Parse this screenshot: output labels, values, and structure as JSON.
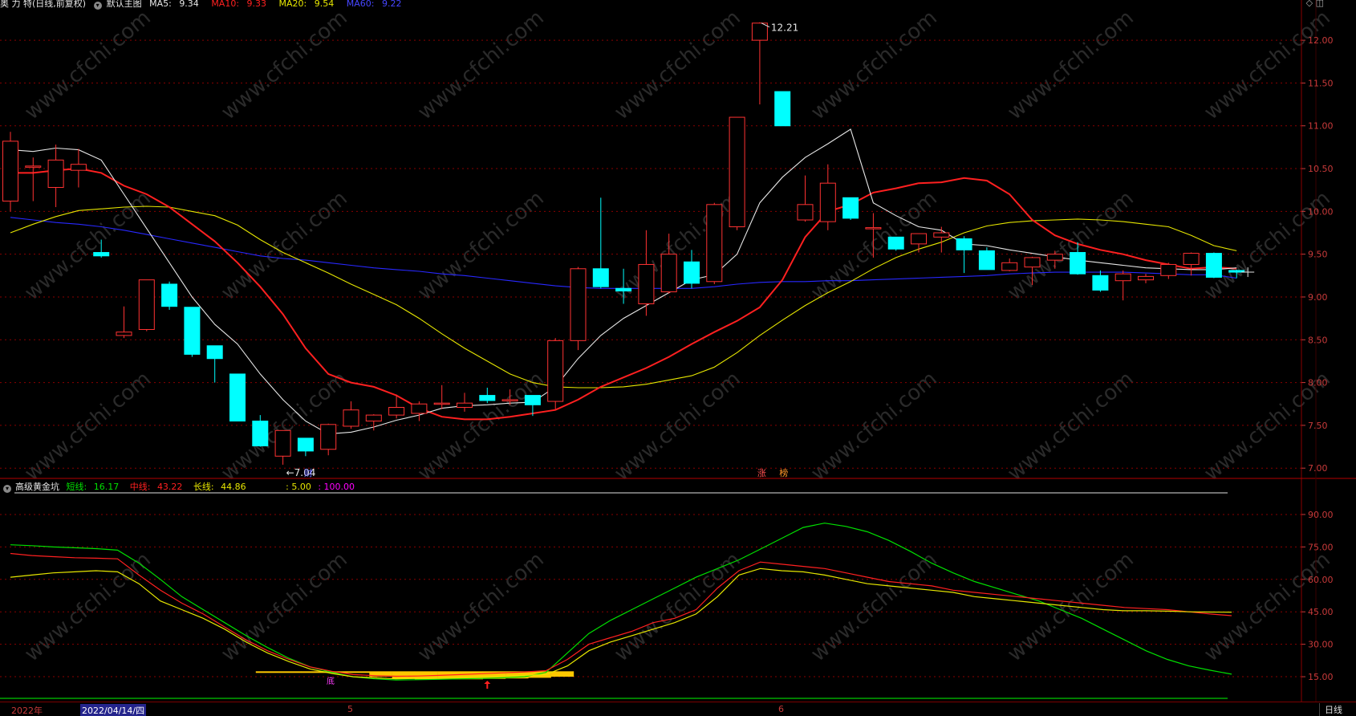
{
  "main_header": {
    "name": "奥 力 特(日线,前复权)",
    "template": "默认主图",
    "ma5_label": "MA5:",
    "ma5_value": "9.34",
    "ma10_label": "MA10:",
    "ma10_value": "9.33",
    "ma20_label": "MA20:",
    "ma20_value": "9.54",
    "ma60_label": "MA60:",
    "ma60_value": "9.22"
  },
  "indicator_header": {
    "name": "高级黄金坑",
    "short_label": "短线:",
    "short_value": "16.17",
    "mid_label": "中线:",
    "mid_value": "43.22",
    "long_label": "长线:",
    "long_value": "44.86",
    "extra1": ": 5.00",
    "extra2": ": 100.00"
  },
  "annotations": {
    "high_label": "12.21",
    "low_label": "7.04",
    "cai_mark": "财",
    "zhang_mark": "涨",
    "bang_mark": "榜",
    "low_zone_mark": "底"
  },
  "bottom_bar": {
    "year": "2022年",
    "cursor_date": "2022/04/14/四",
    "month5": "5",
    "month6": "6",
    "period": "日线"
  },
  "watermark": "www.cfchi.com",
  "colors": {
    "up": "#ff3232",
    "down": "#00ffff",
    "ma5": "#e6e6e6",
    "ma10": "#ff2020",
    "ma20": "#e6e600",
    "ma60": "#2828ff",
    "short": "#00e000",
    "mid": "#ff2020",
    "long": "#e6e600",
    "fill": "#ffc800",
    "grid": "#8a0000"
  },
  "chart_data": [
    {
      "type": "candlestick",
      "title": "奥 力 特(日线,前复权)",
      "y_ticks": [
        7.0,
        7.5,
        8.0,
        8.5,
        9.0,
        9.5,
        10.0,
        10.5,
        11.0,
        11.5,
        12.0
      ],
      "ylim": [
        6.88,
        12.32
      ],
      "candles": [
        {
          "o": 10.12,
          "h": 10.93,
          "l": 10.0,
          "c": 10.82
        },
        {
          "o": 10.53,
          "h": 10.63,
          "l": 10.12,
          "c": 10.53
        },
        {
          "o": 10.28,
          "h": 10.78,
          "l": 10.05,
          "c": 10.6
        },
        {
          "o": 10.48,
          "h": 10.73,
          "l": 10.28,
          "c": 10.55
        },
        {
          "o": 9.52,
          "h": 9.67,
          "l": 9.46,
          "c": 9.48
        },
        {
          "o": 8.55,
          "h": 8.89,
          "l": 8.52,
          "c": 8.59
        },
        {
          "o": 8.62,
          "h": 9.2,
          "l": 8.6,
          "c": 9.2
        },
        {
          "o": 9.15,
          "h": 9.18,
          "l": 8.85,
          "c": 8.89
        },
        {
          "o": 8.88,
          "h": 8.88,
          "l": 8.3,
          "c": 8.33
        },
        {
          "o": 8.43,
          "h": 8.43,
          "l": 8.0,
          "c": 8.28
        },
        {
          "o": 8.1,
          "h": 8.1,
          "l": 7.55,
          "c": 7.55
        },
        {
          "o": 7.55,
          "h": 7.62,
          "l": 7.25,
          "c": 7.26
        },
        {
          "o": 7.14,
          "h": 7.44,
          "l": 7.04,
          "c": 7.44
        },
        {
          "o": 7.35,
          "h": 7.35,
          "l": 7.14,
          "c": 7.2
        },
        {
          "o": 7.22,
          "h": 7.52,
          "l": 7.15,
          "c": 7.51
        },
        {
          "o": 7.49,
          "h": 7.78,
          "l": 7.46,
          "c": 7.68
        },
        {
          "o": 7.55,
          "h": 7.63,
          "l": 7.44,
          "c": 7.62
        },
        {
          "o": 7.62,
          "h": 7.86,
          "l": 7.58,
          "c": 7.71
        },
        {
          "o": 7.64,
          "h": 7.78,
          "l": 7.55,
          "c": 7.75
        },
        {
          "o": 7.76,
          "h": 7.97,
          "l": 7.69,
          "c": 7.76
        },
        {
          "o": 7.71,
          "h": 7.88,
          "l": 7.66,
          "c": 7.76
        },
        {
          "o": 7.85,
          "h": 7.94,
          "l": 7.76,
          "c": 7.79
        },
        {
          "o": 7.8,
          "h": 7.92,
          "l": 7.74,
          "c": 7.8
        },
        {
          "o": 7.85,
          "h": 7.85,
          "l": 7.61,
          "c": 7.74
        },
        {
          "o": 7.78,
          "h": 8.52,
          "l": 7.69,
          "c": 8.49
        },
        {
          "o": 8.49,
          "h": 9.35,
          "l": 8.38,
          "c": 9.33
        },
        {
          "o": 9.33,
          "h": 10.16,
          "l": 9.1,
          "c": 9.12
        },
        {
          "o": 9.1,
          "h": 9.33,
          "l": 8.92,
          "c": 9.07
        },
        {
          "o": 8.92,
          "h": 9.78,
          "l": 8.78,
          "c": 9.38
        },
        {
          "o": 9.06,
          "h": 9.74,
          "l": 9.04,
          "c": 9.5
        },
        {
          "o": 9.41,
          "h": 9.55,
          "l": 9.1,
          "c": 9.16
        },
        {
          "o": 9.18,
          "h": 10.1,
          "l": 9.15,
          "c": 10.08
        },
        {
          "o": 9.82,
          "h": 11.1,
          "l": 9.78,
          "c": 11.1
        },
        {
          "o": 12.0,
          "h": 12.21,
          "l": 11.25,
          "c": 12.2
        },
        {
          "o": 11.4,
          "h": 11.4,
          "l": 11.0,
          "c": 11.0
        },
        {
          "o": 9.9,
          "h": 10.42,
          "l": 9.88,
          "c": 10.08
        },
        {
          "o": 9.88,
          "h": 10.55,
          "l": 9.78,
          "c": 10.33
        },
        {
          "o": 10.16,
          "h": 10.16,
          "l": 9.9,
          "c": 9.92
        },
        {
          "o": 9.81,
          "h": 9.98,
          "l": 9.46,
          "c": 9.81
        },
        {
          "o": 9.7,
          "h": 9.7,
          "l": 9.54,
          "c": 9.56
        },
        {
          "o": 9.62,
          "h": 9.72,
          "l": 9.52,
          "c": 9.74
        },
        {
          "o": 9.7,
          "h": 9.82,
          "l": 9.52,
          "c": 9.75
        },
        {
          "o": 9.68,
          "h": 9.71,
          "l": 9.28,
          "c": 9.55
        },
        {
          "o": 9.54,
          "h": 9.58,
          "l": 9.32,
          "c": 9.32
        },
        {
          "o": 9.31,
          "h": 9.45,
          "l": 9.3,
          "c": 9.4
        },
        {
          "o": 9.35,
          "h": 9.47,
          "l": 9.14,
          "c": 9.46
        },
        {
          "o": 9.43,
          "h": 9.54,
          "l": 9.33,
          "c": 9.5
        },
        {
          "o": 9.52,
          "h": 9.64,
          "l": 9.26,
          "c": 9.27
        },
        {
          "o": 9.25,
          "h": 9.31,
          "l": 9.06,
          "c": 9.08
        },
        {
          "o": 9.19,
          "h": 9.31,
          "l": 8.96,
          "c": 9.27
        },
        {
          "o": 9.2,
          "h": 9.27,
          "l": 9.16,
          "c": 9.24
        },
        {
          "o": 9.25,
          "h": 9.4,
          "l": 9.21,
          "c": 9.38
        },
        {
          "o": 9.38,
          "h": 9.52,
          "l": 9.25,
          "c": 9.51
        },
        {
          "o": 9.51,
          "h": 9.52,
          "l": 9.22,
          "c": 9.23
        },
        {
          "o": 9.31,
          "h": 9.32,
          "l": 9.22,
          "c": 9.29
        }
      ],
      "ma5": [
        10.72,
        10.7,
        10.74,
        10.72,
        10.6,
        10.2,
        9.8,
        9.4,
        9.0,
        8.68,
        8.45,
        8.1,
        7.8,
        7.55,
        7.4,
        7.42,
        7.48,
        7.56,
        7.62,
        7.7,
        7.73,
        7.74,
        7.76,
        7.77,
        7.95,
        8.28,
        8.55,
        8.75,
        8.9,
        9.05,
        9.2,
        9.26,
        9.5,
        10.1,
        10.4,
        10.63,
        10.79,
        10.96,
        10.1,
        9.95,
        9.82,
        9.78,
        9.62,
        9.6,
        9.55,
        9.51,
        9.47,
        9.43,
        9.4,
        9.37,
        9.34,
        9.33,
        9.32,
        9.32,
        9.34
      ],
      "ma10": [
        10.45,
        10.45,
        10.48,
        10.5,
        10.45,
        10.3,
        10.2,
        10.05,
        9.85,
        9.65,
        9.4,
        9.12,
        8.8,
        8.4,
        8.1,
        8.0,
        7.95,
        7.85,
        7.7,
        7.6,
        7.57,
        7.57,
        7.6,
        7.64,
        7.68,
        7.8,
        7.95,
        8.06,
        8.17,
        8.3,
        8.45,
        8.59,
        8.72,
        8.88,
        9.2,
        9.7,
        10.0,
        10.08,
        10.22,
        10.27,
        10.33,
        10.34,
        10.39,
        10.36,
        10.2,
        9.9,
        9.72,
        9.62,
        9.55,
        9.5,
        9.43,
        9.38,
        9.33,
        9.35,
        9.33
      ],
      "ma20": [
        9.75,
        9.85,
        9.94,
        10.01,
        10.03,
        10.05,
        10.06,
        10.05,
        10.0,
        9.95,
        9.84,
        9.67,
        9.52,
        9.4,
        9.28,
        9.15,
        9.03,
        8.91,
        8.75,
        8.57,
        8.4,
        8.25,
        8.1,
        8.0,
        7.95,
        7.94,
        7.94,
        7.95,
        7.98,
        8.03,
        8.08,
        8.18,
        8.35,
        8.55,
        8.73,
        8.9,
        9.05,
        9.18,
        9.33,
        9.46,
        9.56,
        9.64,
        9.75,
        9.83,
        9.87,
        9.89,
        9.9,
        9.91,
        9.9,
        9.88,
        9.85,
        9.82,
        9.72,
        9.6,
        9.54
      ],
      "ma60": [
        9.93,
        9.9,
        9.87,
        9.85,
        9.82,
        9.78,
        9.73,
        9.68,
        9.63,
        9.58,
        9.53,
        9.48,
        9.45,
        9.43,
        9.4,
        9.37,
        9.34,
        9.32,
        9.3,
        9.27,
        9.25,
        9.22,
        9.19,
        9.16,
        9.13,
        9.11,
        9.1,
        9.1,
        9.1,
        9.1,
        9.1,
        9.12,
        9.15,
        9.17,
        9.18,
        9.18,
        9.19,
        9.19,
        9.2,
        9.21,
        9.22,
        9.23,
        9.24,
        9.25,
        9.27,
        9.28,
        9.29,
        9.29,
        9.29,
        9.29,
        9.28,
        9.27,
        9.26,
        9.26,
        9.22
      ]
    },
    {
      "type": "line",
      "title": "高级黄金坑",
      "y_ticks": [
        15.0,
        30.0,
        45.0,
        60.0,
        75.0,
        90.0
      ],
      "ylim": [
        5,
        100
      ],
      "series": [
        {
          "name": "短线",
          "values": [
            76.0,
            75.6,
            75.0,
            74.6,
            74.2,
            73.5,
            67.5,
            60.0,
            52.0,
            46.0,
            40.0,
            34.0,
            28.5,
            23.5,
            19.5,
            17.0,
            15.0,
            14.0,
            13.5,
            13.6,
            13.8,
            14.0,
            14.2,
            14.5,
            15.0,
            17.0,
            26.0,
            35.0,
            41.0,
            46.0,
            51.0,
            56.0,
            61.0,
            65.0,
            69.0,
            74.0,
            79.0,
            84.0,
            86.0,
            84.5,
            82.0,
            78.0,
            73.0,
            67.5,
            63.0,
            59.0,
            56.0,
            53.0,
            50.0,
            46.0,
            42.0,
            37.0,
            32.0,
            27.0,
            23.0,
            20.0,
            18.0,
            16.17
          ]
        },
        {
          "name": "中线",
          "values": [
            72.0,
            71.0,
            70.5,
            70.0,
            69.8,
            69.5,
            62.0,
            55.0,
            49.0,
            44.0,
            38.0,
            32.0,
            27.0,
            23.0,
            19.5,
            17.5,
            16.0,
            15.5,
            15.2,
            15.3,
            15.6,
            16.0,
            16.4,
            16.8,
            17.2,
            17.8,
            23.0,
            30.0,
            33.0,
            36.0,
            40.0,
            42.0,
            46.0,
            56.0,
            64.0,
            68.0,
            67.0,
            66.0,
            65.0,
            63.0,
            61.0,
            59.0,
            58.0,
            57.0,
            55.0,
            54.0,
            53.0,
            52.0,
            51.0,
            50.0,
            49.0,
            48.0,
            47.0,
            46.5,
            46.0,
            45.0,
            44.0,
            43.22
          ]
        },
        {
          "name": "长线",
          "values": [
            61.0,
            62.0,
            63.0,
            63.5,
            64.0,
            63.5,
            58.0,
            50.0,
            46.0,
            42.0,
            37.0,
            31.0,
            26.0,
            22.0,
            18.5,
            16.5,
            15.0,
            14.5,
            14.0,
            14.2,
            14.4,
            14.8,
            15.0,
            15.3,
            15.6,
            16.0,
            20.0,
            27.0,
            31.0,
            34.0,
            37.0,
            40.0,
            44.0,
            52.0,
            62.0,
            65.0,
            64.0,
            63.5,
            62.0,
            60.0,
            58.0,
            57.0,
            56.0,
            55.0,
            54.0,
            52.0,
            51.0,
            50.0,
            49.0,
            48.0,
            47.0,
            46.0,
            45.5,
            45.5,
            45.3,
            45.0,
            44.9,
            44.86
          ]
        }
      ]
    }
  ]
}
